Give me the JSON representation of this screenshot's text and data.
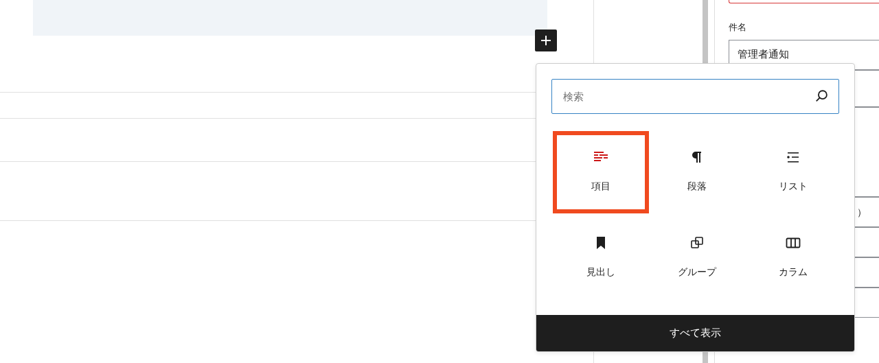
{
  "sidebar": {
    "subject_label": "件名",
    "subject_value": "管理者通知",
    "fragment": "）"
  },
  "inserter": {
    "search": {
      "placeholder": "検索"
    },
    "blocks": [
      {
        "kind": "form",
        "label": "項目",
        "selected": true
      },
      {
        "kind": "paragraph",
        "label": "段落",
        "selected": false
      },
      {
        "kind": "list",
        "label": "リスト",
        "selected": false
      },
      {
        "kind": "heading",
        "label": "見出し",
        "selected": false
      },
      {
        "kind": "group",
        "label": "グループ",
        "selected": false
      },
      {
        "kind": "columns",
        "label": "カラム",
        "selected": false
      }
    ],
    "browse_all": "すべて表示"
  }
}
